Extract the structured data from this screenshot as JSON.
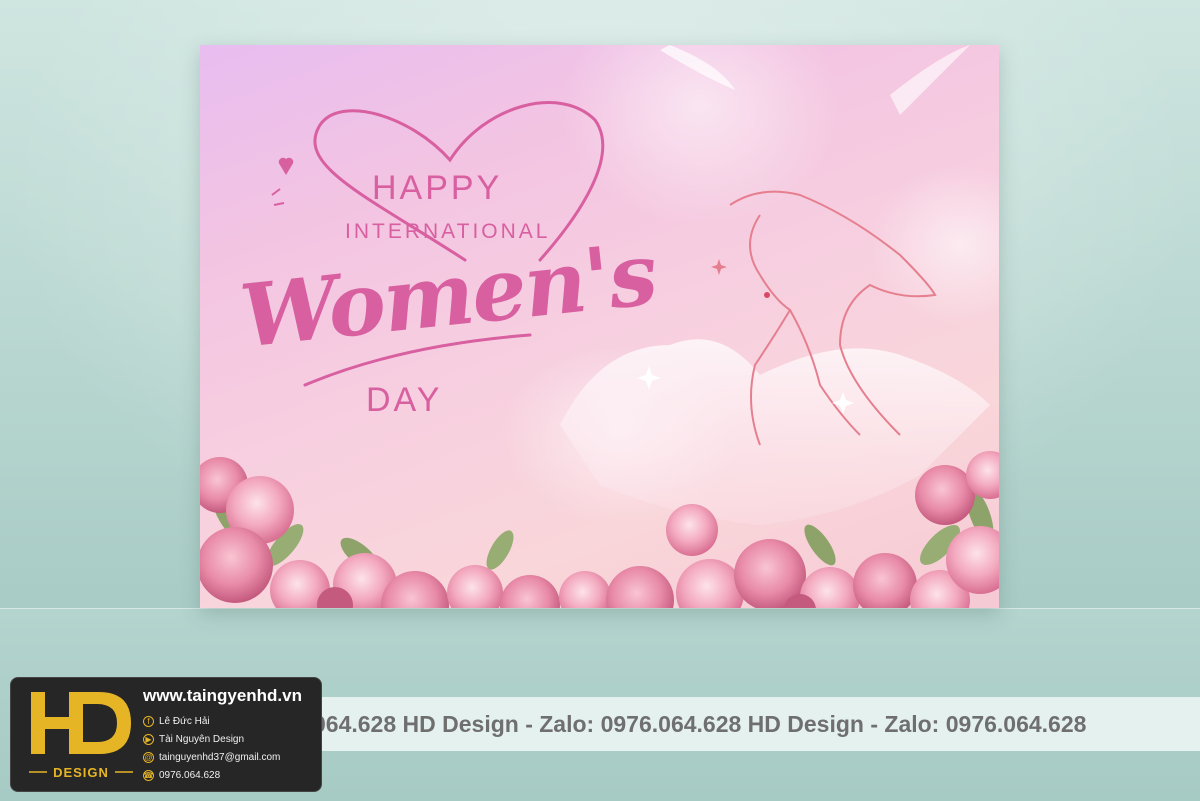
{
  "banner": {
    "line1": "HAPPY",
    "line2": "INTERNATIONAL",
    "line3": "Women's",
    "line4": "DAY"
  },
  "ticker": {
    "text": "064.628   HD Design - Zalo: 0976.064.628   HD Design - Zalo: 0976.064.628"
  },
  "card": {
    "logo_word": "DESIGN",
    "website": "www.taingyenhd.vn",
    "facebook": "Lê Đức Hải",
    "youtube": "Tài Nguyên Design",
    "email": "tainguyenhd37@gmail.com",
    "phone": "0976.064.628"
  },
  "colors": {
    "accent_pink": "#d85fa0",
    "logo_gold": "#e6b526",
    "card_bg": "#262626"
  }
}
